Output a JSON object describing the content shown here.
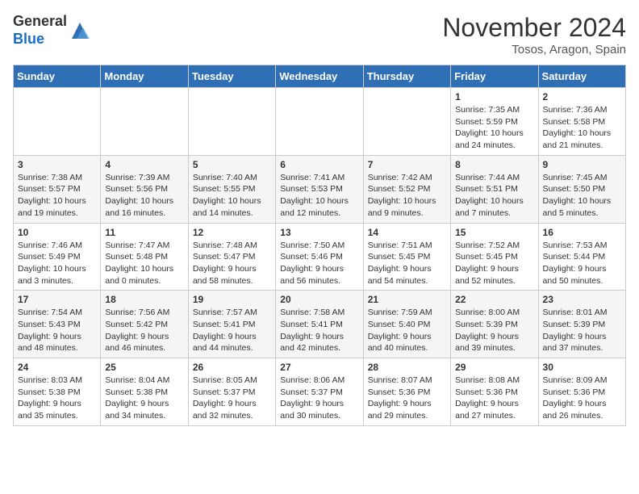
{
  "logo": {
    "general": "General",
    "blue": "Blue"
  },
  "title": "November 2024",
  "location": "Tosos, Aragon, Spain",
  "days_header": [
    "Sunday",
    "Monday",
    "Tuesday",
    "Wednesday",
    "Thursday",
    "Friday",
    "Saturday"
  ],
  "weeks": [
    [
      {
        "day": "",
        "info": ""
      },
      {
        "day": "",
        "info": ""
      },
      {
        "day": "",
        "info": ""
      },
      {
        "day": "",
        "info": ""
      },
      {
        "day": "",
        "info": ""
      },
      {
        "day": "1",
        "info": "Sunrise: 7:35 AM\nSunset: 5:59 PM\nDaylight: 10 hours\nand 24 minutes."
      },
      {
        "day": "2",
        "info": "Sunrise: 7:36 AM\nSunset: 5:58 PM\nDaylight: 10 hours\nand 21 minutes."
      }
    ],
    [
      {
        "day": "3",
        "info": "Sunrise: 7:38 AM\nSunset: 5:57 PM\nDaylight: 10 hours\nand 19 minutes."
      },
      {
        "day": "4",
        "info": "Sunrise: 7:39 AM\nSunset: 5:56 PM\nDaylight: 10 hours\nand 16 minutes."
      },
      {
        "day": "5",
        "info": "Sunrise: 7:40 AM\nSunset: 5:55 PM\nDaylight: 10 hours\nand 14 minutes."
      },
      {
        "day": "6",
        "info": "Sunrise: 7:41 AM\nSunset: 5:53 PM\nDaylight: 10 hours\nand 12 minutes."
      },
      {
        "day": "7",
        "info": "Sunrise: 7:42 AM\nSunset: 5:52 PM\nDaylight: 10 hours\nand 9 minutes."
      },
      {
        "day": "8",
        "info": "Sunrise: 7:44 AM\nSunset: 5:51 PM\nDaylight: 10 hours\nand 7 minutes."
      },
      {
        "day": "9",
        "info": "Sunrise: 7:45 AM\nSunset: 5:50 PM\nDaylight: 10 hours\nand 5 minutes."
      }
    ],
    [
      {
        "day": "10",
        "info": "Sunrise: 7:46 AM\nSunset: 5:49 PM\nDaylight: 10 hours\nand 3 minutes."
      },
      {
        "day": "11",
        "info": "Sunrise: 7:47 AM\nSunset: 5:48 PM\nDaylight: 10 hours\nand 0 minutes."
      },
      {
        "day": "12",
        "info": "Sunrise: 7:48 AM\nSunset: 5:47 PM\nDaylight: 9 hours\nand 58 minutes."
      },
      {
        "day": "13",
        "info": "Sunrise: 7:50 AM\nSunset: 5:46 PM\nDaylight: 9 hours\nand 56 minutes."
      },
      {
        "day": "14",
        "info": "Sunrise: 7:51 AM\nSunset: 5:45 PM\nDaylight: 9 hours\nand 54 minutes."
      },
      {
        "day": "15",
        "info": "Sunrise: 7:52 AM\nSunset: 5:45 PM\nDaylight: 9 hours\nand 52 minutes."
      },
      {
        "day": "16",
        "info": "Sunrise: 7:53 AM\nSunset: 5:44 PM\nDaylight: 9 hours\nand 50 minutes."
      }
    ],
    [
      {
        "day": "17",
        "info": "Sunrise: 7:54 AM\nSunset: 5:43 PM\nDaylight: 9 hours\nand 48 minutes."
      },
      {
        "day": "18",
        "info": "Sunrise: 7:56 AM\nSunset: 5:42 PM\nDaylight: 9 hours\nand 46 minutes."
      },
      {
        "day": "19",
        "info": "Sunrise: 7:57 AM\nSunset: 5:41 PM\nDaylight: 9 hours\nand 44 minutes."
      },
      {
        "day": "20",
        "info": "Sunrise: 7:58 AM\nSunset: 5:41 PM\nDaylight: 9 hours\nand 42 minutes."
      },
      {
        "day": "21",
        "info": "Sunrise: 7:59 AM\nSunset: 5:40 PM\nDaylight: 9 hours\nand 40 minutes."
      },
      {
        "day": "22",
        "info": "Sunrise: 8:00 AM\nSunset: 5:39 PM\nDaylight: 9 hours\nand 39 minutes."
      },
      {
        "day": "23",
        "info": "Sunrise: 8:01 AM\nSunset: 5:39 PM\nDaylight: 9 hours\nand 37 minutes."
      }
    ],
    [
      {
        "day": "24",
        "info": "Sunrise: 8:03 AM\nSunset: 5:38 PM\nDaylight: 9 hours\nand 35 minutes."
      },
      {
        "day": "25",
        "info": "Sunrise: 8:04 AM\nSunset: 5:38 PM\nDaylight: 9 hours\nand 34 minutes."
      },
      {
        "day": "26",
        "info": "Sunrise: 8:05 AM\nSunset: 5:37 PM\nDaylight: 9 hours\nand 32 minutes."
      },
      {
        "day": "27",
        "info": "Sunrise: 8:06 AM\nSunset: 5:37 PM\nDaylight: 9 hours\nand 30 minutes."
      },
      {
        "day": "28",
        "info": "Sunrise: 8:07 AM\nSunset: 5:36 PM\nDaylight: 9 hours\nand 29 minutes."
      },
      {
        "day": "29",
        "info": "Sunrise: 8:08 AM\nSunset: 5:36 PM\nDaylight: 9 hours\nand 27 minutes."
      },
      {
        "day": "30",
        "info": "Sunrise: 8:09 AM\nSunset: 5:36 PM\nDaylight: 9 hours\nand 26 minutes."
      }
    ]
  ]
}
